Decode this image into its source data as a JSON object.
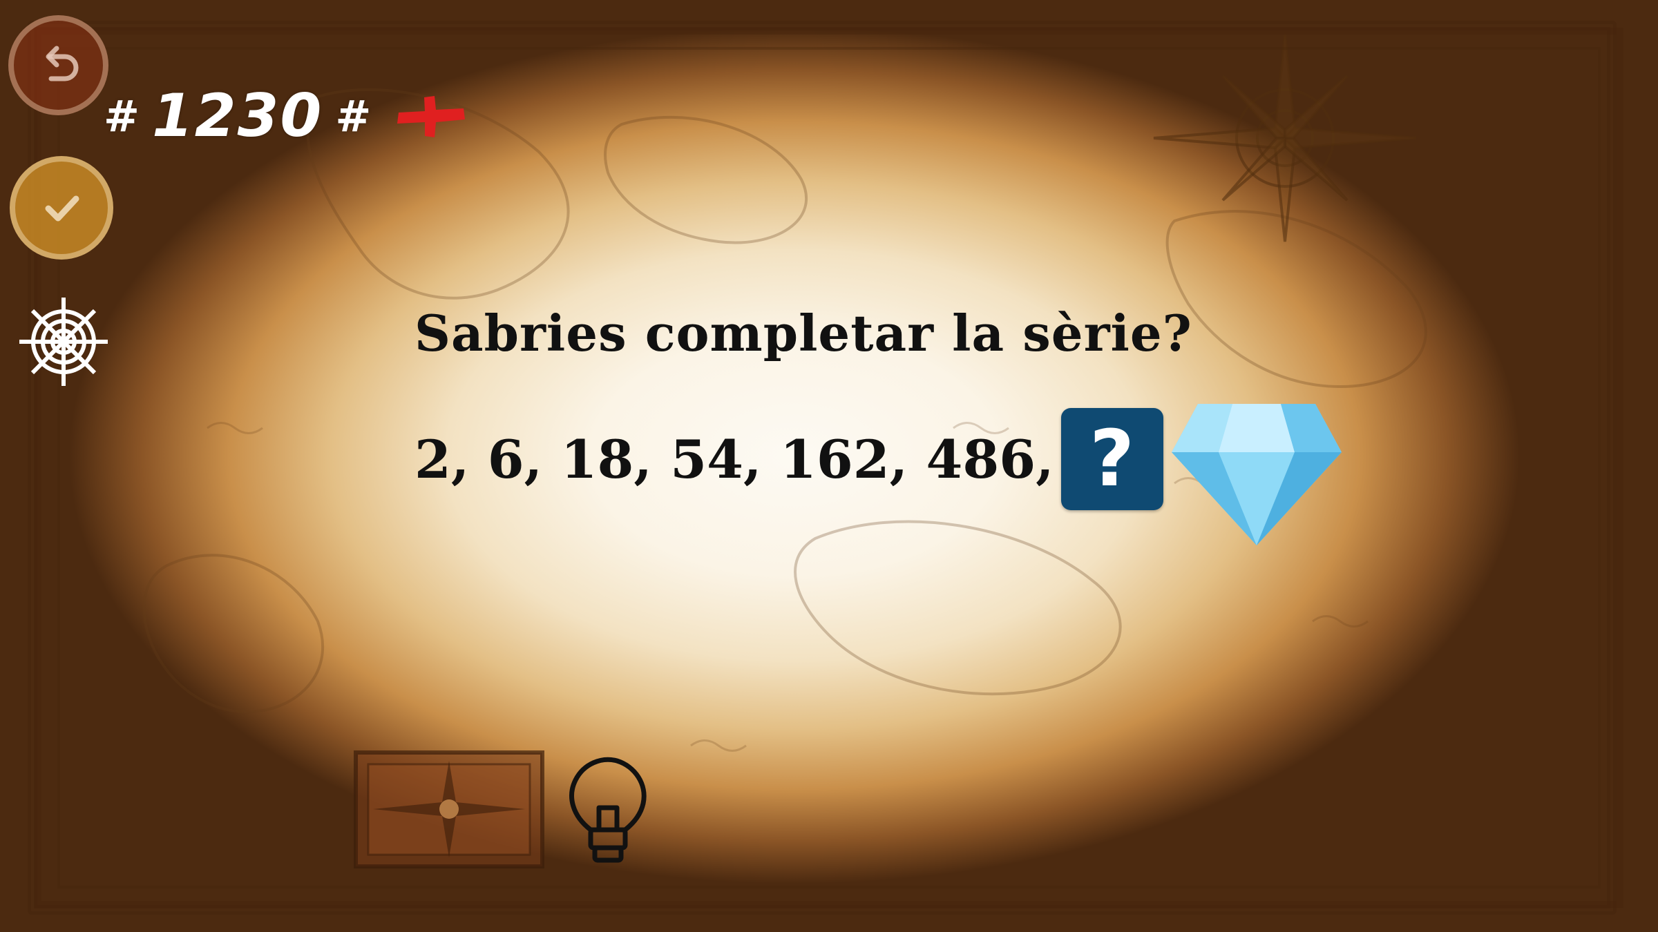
{
  "level": {
    "hash_left": "#",
    "number": "1230",
    "hash_right": "#"
  },
  "puzzle": {
    "question": "Sabries completar la sèrie?",
    "series": "2, 6, 18, 54, 162, 486,",
    "answer_placeholder": "?"
  },
  "colors": {
    "answer_box": "#0f4a72",
    "gem": "#7fd3f5",
    "marker": "#e02020",
    "check_button": "#d7962a",
    "back_button": "#8c3214"
  },
  "icons": {
    "back": "undo-arrow-icon",
    "check": "checkmark-icon",
    "settings": "ship-wheel-icon",
    "reward": "diamond-gem-icon",
    "hint": "lightbulb-icon",
    "marker": "red-cross-marker-icon",
    "map": "compass-rose-box-icon"
  }
}
